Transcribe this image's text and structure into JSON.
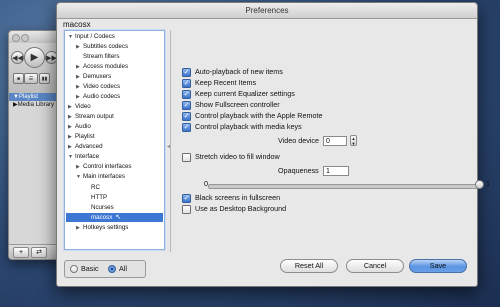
{
  "window_title": "Preferences",
  "section_title": "macosx",
  "player": {
    "playlist_header": "Playlist",
    "media_library": "Media Library",
    "add_label": "+",
    "shuffle_label": "⇄"
  },
  "tree": [
    {
      "label": "Input / Codecs",
      "arrow": "▼"
    },
    {
      "label": "Subtitles codecs",
      "arrow": "▶"
    },
    {
      "label": "Stream filters",
      "arrow": ""
    },
    {
      "label": "Access modules",
      "arrow": "▶"
    },
    {
      "label": "Demuxers",
      "arrow": "▶"
    },
    {
      "label": "Video codecs",
      "arrow": "▶"
    },
    {
      "label": "Audio codecs",
      "arrow": "▶"
    },
    {
      "label": "Video",
      "arrow": "▶"
    },
    {
      "label": "Stream output",
      "arrow": "▶"
    },
    {
      "label": "Audio",
      "arrow": "▶"
    },
    {
      "label": "Playlist",
      "arrow": "▶"
    },
    {
      "label": "Advanced",
      "arrow": "▶"
    },
    {
      "label": "Interface",
      "arrow": "▼"
    },
    {
      "label": "Control interfaces",
      "arrow": "▶"
    },
    {
      "label": "Main interfaces",
      "arrow": "▼"
    },
    {
      "label": "RC",
      "arrow": ""
    },
    {
      "label": "HTTP",
      "arrow": ""
    },
    {
      "label": "Ncurses",
      "arrow": ""
    },
    {
      "label": "macosx",
      "arrow": "",
      "selected": true
    },
    {
      "label": "Hotkeys settings",
      "arrow": "▶"
    }
  ],
  "options": {
    "autoplay": {
      "label": "Auto-playback of new items",
      "checked": true
    },
    "keep_recent": {
      "label": "Keep Recent Items",
      "checked": true
    },
    "keep_eq": {
      "label": "Keep current Equalizer settings",
      "checked": true
    },
    "fullscreen_ctl": {
      "label": "Show Fullscreen controller",
      "checked": true
    },
    "apple_remote": {
      "label": "Control playback with the Apple Remote",
      "checked": true
    },
    "media_keys": {
      "label": "Control playback with media keys",
      "checked": true
    },
    "stretch": {
      "label": "Stretch video to fill window",
      "checked": false
    },
    "black_screens": {
      "label": "Black screens in fullscreen",
      "checked": true
    },
    "desktop_bg": {
      "label": "Use as Desktop Background",
      "checked": false
    }
  },
  "video_device": {
    "label": "Video device",
    "value": "0"
  },
  "opaqueness": {
    "label": "Opaqueness",
    "value": "1",
    "min": "0",
    "max": "1",
    "level": 1.0
  },
  "footer": {
    "basic": "Basic",
    "all": "All",
    "selected_view": "All",
    "reset": "Reset All",
    "cancel": "Cancel",
    "save": "Save"
  }
}
